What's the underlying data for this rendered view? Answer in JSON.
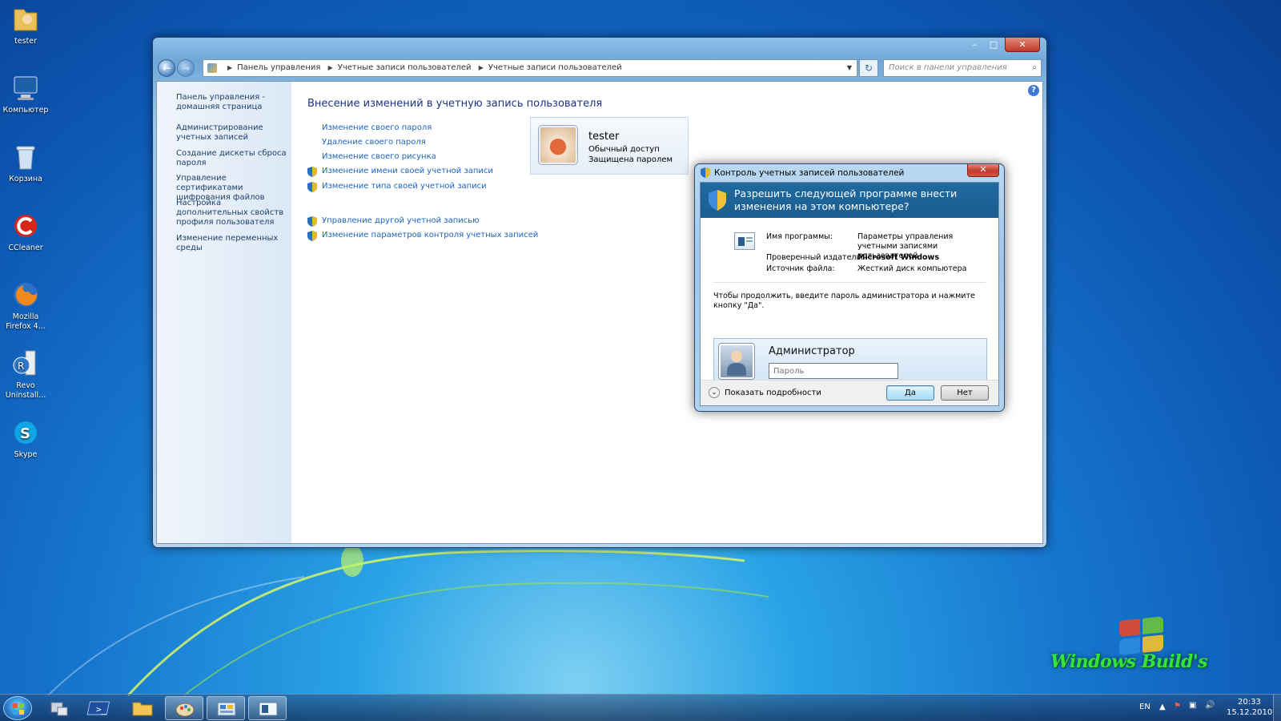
{
  "desktop": {
    "icons": [
      {
        "label": "tester",
        "icon": "user-folder-icon"
      },
      {
        "label": "Компьютер",
        "icon": "computer-icon"
      },
      {
        "label": "Корзина",
        "icon": "recycle-bin-icon"
      },
      {
        "label": "CCleaner",
        "icon": "ccleaner-icon"
      },
      {
        "label": "Mozilla Firefox 4...",
        "icon": "firefox-icon"
      },
      {
        "label": "Revo Uninstall...",
        "icon": "revo-uninstaller-icon"
      },
      {
        "label": "Skype",
        "icon": "skype-icon"
      }
    ],
    "watermark": "Windows Build's"
  },
  "window": {
    "address": {
      "crumbs": [
        "Панель управления",
        "Учетные записи пользователей",
        "Учетные записи пользователей"
      ]
    },
    "search_placeholder": "Поиск в панели управления",
    "sidebar": [
      "Панель управления - домашняя страница",
      "Администрирование учетных записей",
      "Создание дискеты сброса пароля",
      "Управление сертификатами шифрования файлов",
      "Настройка дополнительных свойств профиля пользователя",
      "Изменение переменных среды"
    ],
    "main_title": "Внесение изменений в учетную запись пользователя",
    "links": [
      {
        "text": "Изменение своего пароля",
        "shield": false
      },
      {
        "text": "Удаление своего пароля",
        "shield": false
      },
      {
        "text": "Изменение своего рисунка",
        "shield": false
      },
      {
        "text": "Изменение имени своей учетной записи",
        "shield": true
      },
      {
        "text": "Изменение типа своей учетной записи",
        "shield": true
      },
      {
        "text": "Управление другой учетной записью",
        "shield": true
      },
      {
        "text": "Изменение параметров контроля учетных записей",
        "shield": true
      }
    ],
    "user_card": {
      "name": "tester",
      "type": "Обычный доступ",
      "status": "Защищена паролем"
    }
  },
  "uac": {
    "title": "Контроль учетных записей пользователей",
    "question": "Разрешить следующей программе внести изменения на этом компьютере?",
    "program_label": "Имя программы:",
    "program_value": "Параметры управления учетными записями пользователей",
    "publisher_label": "Проверенный издатель:",
    "publisher_value": "Microsoft Windows",
    "source_label": "Источник файла:",
    "source_value": "Жесткий диск компьютера",
    "prompt": "Чтобы продолжить, введите пароль администратора и нажмите кнопку \"Да\".",
    "account_name": "Администратор",
    "password_placeholder": "Пароль",
    "details_label": "Показать подробности",
    "yes_label": "Да",
    "no_label": "Нет"
  },
  "taskbar": {
    "language": "EN",
    "time": "20:33",
    "date": "15.12.2010"
  },
  "colors": {
    "uac_header": "#1f6aa0",
    "link": "#1c62c2",
    "title": "#1e3287"
  }
}
